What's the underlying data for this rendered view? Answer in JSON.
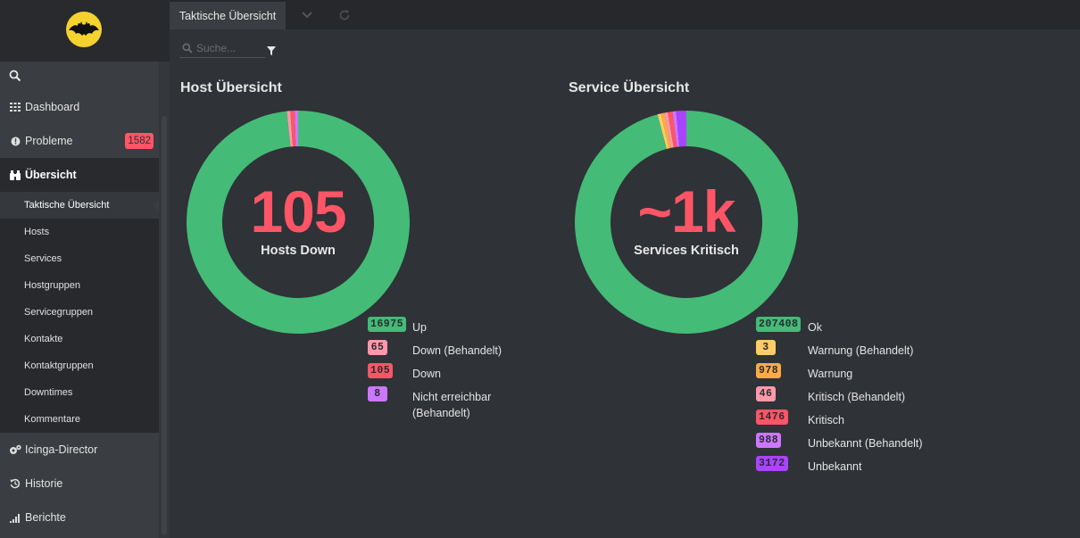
{
  "colors": {
    "ok": "#44bb77",
    "warning": "#ffaa44",
    "warning_handled": "#ffcc66",
    "critical": "#ff5566",
    "critical_handled": "#ff99aa",
    "unknown": "#aa44ff",
    "unknown_handled": "#cc77ff",
    "sidebar_bg": "#3a3d41",
    "content_bg": "#2f3237"
  },
  "sidebar": {
    "logo_icon": "batman-logo-icon",
    "search_icon": "search-icon",
    "items": [
      {
        "label": "Dashboard",
        "icon": "dashboard-grid-icon"
      },
      {
        "label": "Probleme",
        "icon": "alert-circle-icon",
        "badge": "1582"
      },
      {
        "label": "Übersicht",
        "icon": "binoculars-icon"
      },
      {
        "label": "Icinga-Director",
        "icon": "cogs-icon"
      },
      {
        "label": "Historie",
        "icon": "history-icon"
      },
      {
        "label": "Berichte",
        "icon": "bar-chart-icon"
      }
    ],
    "sub_items": [
      {
        "label": "Taktische Übersicht"
      },
      {
        "label": "Hosts"
      },
      {
        "label": "Services"
      },
      {
        "label": "Hostgruppen"
      },
      {
        "label": "Servicegruppen"
      },
      {
        "label": "Kontakte"
      },
      {
        "label": "Kontaktgruppen"
      },
      {
        "label": "Downtimes"
      },
      {
        "label": "Kommentare"
      }
    ]
  },
  "tabs": {
    "active_label": "Taktische Übersicht",
    "dropdown_icon": "chevron-down-icon",
    "refresh_icon": "refresh-icon"
  },
  "search": {
    "placeholder": "Suche...",
    "filter_icon": "filter-icon"
  },
  "host_overview": {
    "title": "Host Übersicht",
    "big_number": "105",
    "big_label": "Hosts Down",
    "legend": [
      {
        "count": "16975",
        "label": "Up",
        "color": "#44bb77"
      },
      {
        "count": "65",
        "label": "Down (Behandelt)",
        "color": "#ff99aa"
      },
      {
        "count": "105",
        "label": "Down",
        "color": "#ff5566"
      },
      {
        "count": "8",
        "label": "Nicht erreichbar (Behandelt)",
        "color": "#cc77ff"
      }
    ],
    "chart_values": [
      16975,
      65,
      105,
      8
    ]
  },
  "service_overview": {
    "title": "Service Übersicht",
    "big_number": "~1k",
    "big_label": "Services Kritisch",
    "legend": [
      {
        "count": "207408",
        "label": "Ok",
        "color": "#44bb77"
      },
      {
        "count": "3",
        "label": "Warnung (Behandelt)",
        "color": "#ffcc66"
      },
      {
        "count": "978",
        "label": "Warnung",
        "color": "#ffaa44"
      },
      {
        "count": "46",
        "label": "Kritisch (Behandelt)",
        "color": "#ff99aa"
      },
      {
        "count": "1476",
        "label": "Kritisch",
        "color": "#ff5566"
      },
      {
        "count": "988",
        "label": "Unbekannt (Behandelt)",
        "color": "#cc77ff"
      },
      {
        "count": "3172",
        "label": "Unbekannt",
        "color": "#aa44ff"
      }
    ],
    "chart_values": [
      207408,
      3,
      978,
      46,
      1476,
      988,
      3172
    ]
  }
}
